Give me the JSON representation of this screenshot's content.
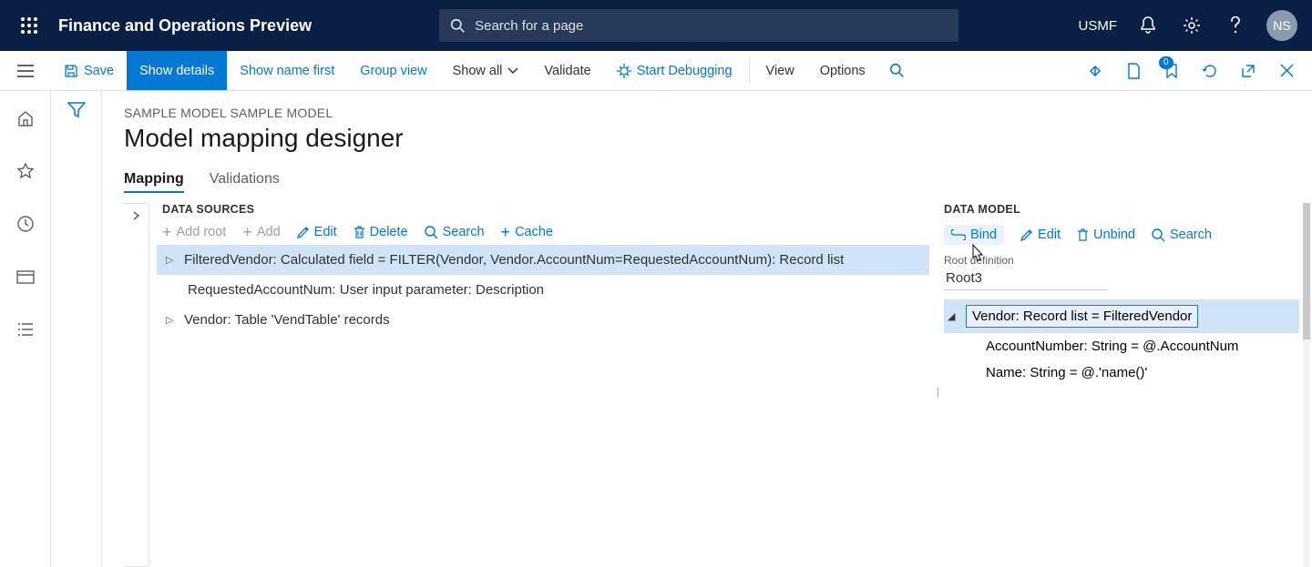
{
  "top": {
    "app_title": "Finance and Operations Preview",
    "search_placeholder": "Search for a page",
    "company": "USMF",
    "avatar_initials": "NS"
  },
  "actions": {
    "save": "Save",
    "show_details": "Show details",
    "show_name_first": "Show name first",
    "group_view": "Group view",
    "show_all": "Show all",
    "validate": "Validate",
    "start_debugging": "Start Debugging",
    "view": "View",
    "options": "Options",
    "badge_count": "0"
  },
  "page": {
    "breadcrumb": "SAMPLE MODEL SAMPLE MODEL",
    "title": "Model mapping designer"
  },
  "tabs": {
    "mapping": "Mapping",
    "validations": "Validations"
  },
  "data_sources": {
    "title": "DATA SOURCES",
    "toolbar": {
      "add_root": "Add root",
      "add": "Add",
      "edit": "Edit",
      "delete": "Delete",
      "search": "Search",
      "cache": "Cache"
    },
    "rows": [
      "FilteredVendor: Calculated field = FILTER(Vendor, Vendor.AccountNum=RequestedAccountNum): Record list",
      "RequestedAccountNum: User input parameter: Description",
      "Vendor: Table 'VendTable' records"
    ]
  },
  "data_model": {
    "title": "DATA MODEL",
    "toolbar": {
      "bind": "Bind",
      "edit": "Edit",
      "unbind": "Unbind",
      "search": "Search"
    },
    "root_def_label": "Root definition",
    "root_def_value": "Root3",
    "rows": [
      "Vendor: Record list = FilteredVendor",
      "AccountNumber: String = @.AccountNum",
      "Name: String = @.'name()'"
    ]
  }
}
